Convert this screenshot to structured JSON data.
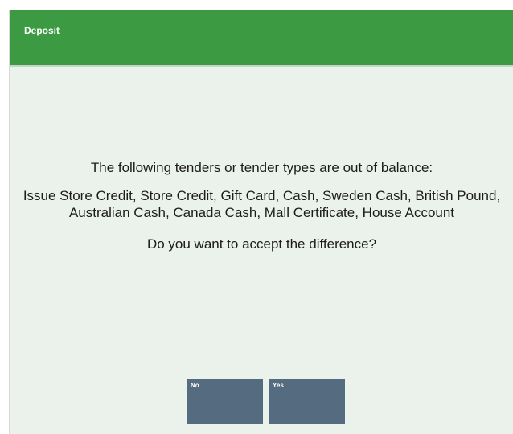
{
  "dialog": {
    "title": "Deposit",
    "message_intro": "The following tenders or tender types are out of balance:",
    "tender_list": "Issue Store Credit, Store Credit, Gift Card, Cash, Sweden Cash, British Pound, Australian Cash, Canada Cash, Mall Certificate, House Account",
    "question": "Do you want to accept the difference?",
    "buttons": {
      "no_label": "No",
      "yes_label": "Yes"
    }
  },
  "colors": {
    "title_bar": "#3b9a42",
    "background": "#ebf1eb",
    "button": "#546b80"
  }
}
